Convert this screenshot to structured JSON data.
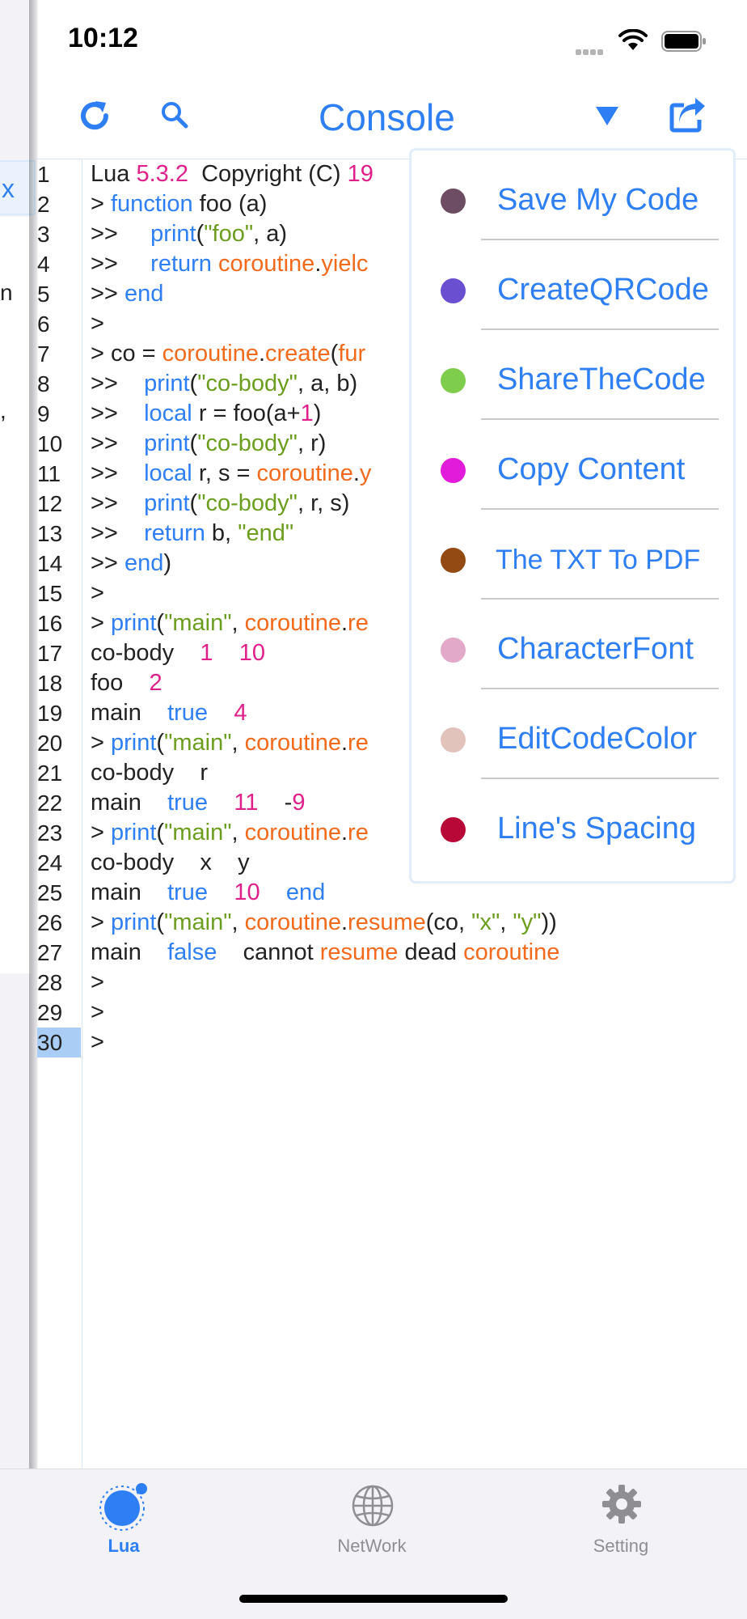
{
  "status": {
    "time": "10:12"
  },
  "left_panel": {
    "close_glyph": "x",
    "fragment_chars": [
      "n",
      ","
    ]
  },
  "header": {
    "title": "Console",
    "refresh_icon": "refresh-icon",
    "search_icon": "search-icon",
    "dropdown_icon": "triangle-down-icon",
    "share_icon": "share-icon"
  },
  "editor": {
    "selected_line": 30,
    "line_numbers": [
      "1",
      "2",
      "3",
      "4",
      "5",
      "6",
      "7",
      "8",
      "9",
      "10",
      "11",
      "12",
      "13",
      "14",
      "15",
      "16",
      "17",
      "18",
      "19",
      "20",
      "21",
      "22",
      "23",
      "24",
      "25",
      "26",
      "27",
      "28",
      "29",
      "30"
    ],
    "lines": [
      "Lua 5.3.2  Copyright (C) 19",
      "> function foo (a)",
      ">>     print(\"foo\", a)",
      ">>     return coroutine.yielc",
      ">> end",
      ">",
      "> co = coroutine.create(fur",
      ">>    print(\"co-body\", a, b)",
      ">>    local r = foo(a+1)",
      ">>    print(\"co-body\", r)",
      ">>    local r, s = coroutine.y",
      ">>    print(\"co-body\", r, s)",
      ">>    return b, \"end\"",
      ">> end)",
      ">",
      "> print(\"main\", coroutine.re",
      "co-body    1    10",
      "foo    2",
      "main    true    4",
      "> print(\"main\", coroutine.re",
      "co-body    r",
      "main    true    11    -9",
      "> print(\"main\", coroutine.re",
      "co-body    x    y",
      "main    true    10    end",
      "> print(\"main\", coroutine.resume(co, \"x\", \"y\"))",
      "main    false    cannot resume dead coroutine",
      ">",
      ">",
      ">"
    ]
  },
  "menu": {
    "items": [
      {
        "label": "Save My Code",
        "color": "#6d4d63"
      },
      {
        "label": "CreateQRCode",
        "color": "#6b4fd1"
      },
      {
        "label": "ShareTheCode",
        "color": "#7fcd4c"
      },
      {
        "label": "Copy Content",
        "color": "#e21ad9"
      },
      {
        "label": "The TXT To PDF",
        "color": "#934b13"
      },
      {
        "label": "CharacterFont",
        "color": "#e2a9c9"
      },
      {
        "label": "EditCodeColor",
        "color": "#e2c3bc"
      },
      {
        "label": "Line's Spacing",
        "color": "#b80838"
      }
    ]
  },
  "tabbar": {
    "tabs": [
      {
        "label": "Lua",
        "icon": "lua-icon",
        "active": true
      },
      {
        "label": "NetWork",
        "icon": "globe-icon",
        "active": false
      },
      {
        "label": "Setting",
        "icon": "gear-icon",
        "active": false
      }
    ]
  },
  "colors": {
    "accent": "#2e7ff3",
    "keyword": "#2e7ff3",
    "function": "#f26a1b",
    "string": "#6b9e1d",
    "number": "#e0208a"
  }
}
